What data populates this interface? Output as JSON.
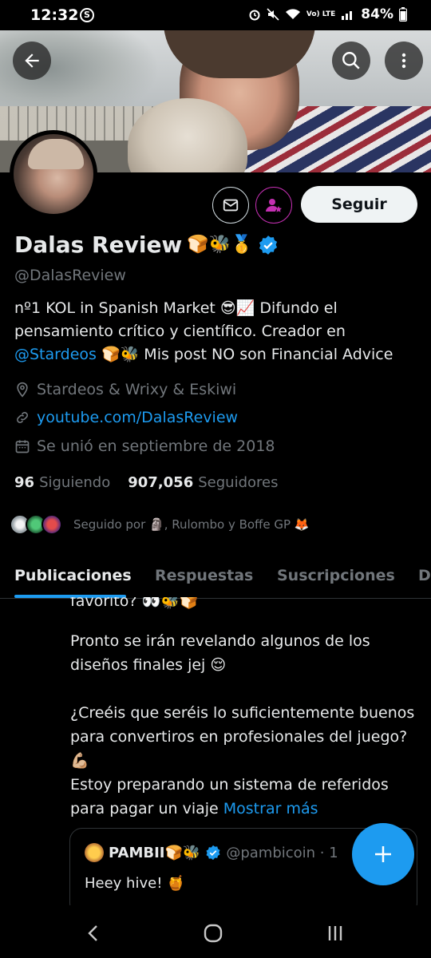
{
  "status_bar": {
    "time": "12:32",
    "app_icon": "S",
    "network_label": "Vo) LTE",
    "battery": "84%"
  },
  "header": {
    "back_icon": "arrow-left-icon",
    "search_icon": "search-icon",
    "more_icon": "more-vertical-icon"
  },
  "profile": {
    "follow_label": "Seguir",
    "name": "Dalas Review",
    "name_emojis": "🍞🐝🥇",
    "handle": "@DalasReview",
    "bio_line1": "nº1 KOL in Spanish Market 😎📈 Difundo el",
    "bio_line2": "pensamiento crítico y científico. Creador en",
    "bio_mention": "@Stardeos",
    "bio_line3_rest": " 🍞🐝 Mis post NO son Financial Advice",
    "location": "Stardeos & Wrixy & Eskiwi",
    "website": "youtube.com/DalasReview",
    "joined": "Se unió en septiembre de 2018",
    "following_count": "96",
    "following_label": "Siguiendo",
    "followers_count": "907,056",
    "followers_label": "Seguidores",
    "followed_by": "Seguido por 🗿, Rulombo y Boffe GP 🦊"
  },
  "tabs": [
    {
      "label": "Publicaciones",
      "active": true
    },
    {
      "label": "Respuestas",
      "active": false
    },
    {
      "label": "Suscripciones",
      "active": false
    },
    {
      "label": "D",
      "active": false
    }
  ],
  "tweet": {
    "line_clip": "favorito? 👀🐝🍞",
    "para2": "Pronto se irán revelando algunos de los diseños finales jej 😌",
    "para3": "¿Creéis que seréis lo suficientemente buenos para convertiros en profesionales del juego? 💪🏼",
    "para4_text": "Estoy preparando un sistema de referidos para pagar un viaje",
    "show_more": "Mostrar más",
    "quote": {
      "name": "PAMBII🍞🐝",
      "handle": "@pambicoin · 1",
      "body": "Heey hive! 🍯"
    }
  },
  "colors": {
    "accent": "#1d9bf0",
    "subscribe": "#c42fb2",
    "background": "#000000",
    "muted": "#71767b"
  }
}
